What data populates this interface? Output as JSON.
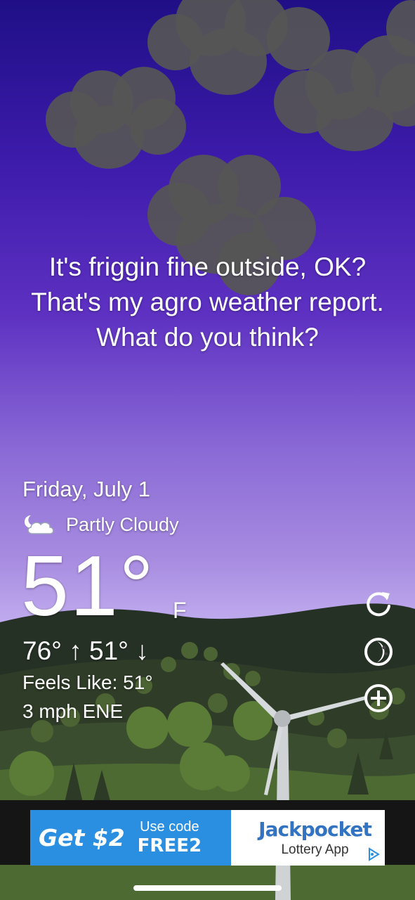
{
  "quote": "It's friggin fine outside, OK? That's my agro weather report. What do you think?",
  "weather": {
    "date": "Friday, July 1",
    "condition": "Partly Cloudy",
    "condition_icon": "partly-cloudy-night-icon",
    "temperature": "51°",
    "unit": "F",
    "hilo": "76° ↑  51° ↓",
    "feels_like": "Feels Like: 51°",
    "wind": "3 mph ENE"
  },
  "controls": [
    {
      "icon": "refresh-icon"
    },
    {
      "icon": "moon-phase-icon"
    },
    {
      "icon": "add-location-icon"
    }
  ],
  "ad": {
    "headline": "Get $2",
    "code_label": "Use code",
    "code": "FREE2",
    "brand": "Jackpocket",
    "tagline": "Lottery App",
    "accent_color": "#2a8fe0",
    "brand_color": "#3273c2"
  }
}
